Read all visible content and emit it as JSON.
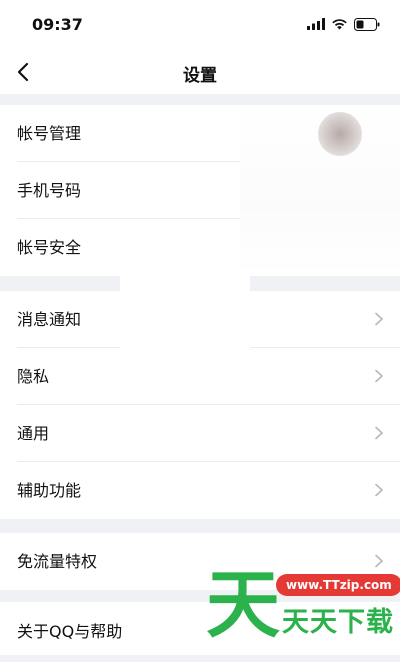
{
  "status": {
    "time": "09:37"
  },
  "nav": {
    "title": "设置"
  },
  "groups": {
    "account": [
      {
        "label": "帐号管理"
      },
      {
        "label": "手机号码"
      },
      {
        "label": "帐号安全"
      }
    ],
    "general": [
      {
        "label": "消息通知"
      },
      {
        "label": "隐私"
      },
      {
        "label": "通用"
      },
      {
        "label": "辅助功能"
      }
    ],
    "traffic": [
      {
        "label": "免流量特权"
      }
    ],
    "about": [
      {
        "label": "关于QQ与帮助"
      }
    ]
  },
  "watermark": {
    "url": "www.TTzip.com",
    "text": "天天下载",
    "glyph": "天"
  },
  "colors": {
    "background": "#f0f1f4",
    "separator": "#ececec",
    "chevron": "#b8b8b8",
    "watermark_green": "#2bb24c",
    "watermark_red": "#e53935"
  },
  "icons": [
    "back-arrow-icon",
    "cellular-signal-icon",
    "wifi-icon",
    "battery-icon",
    "chevron-right-icon"
  ]
}
